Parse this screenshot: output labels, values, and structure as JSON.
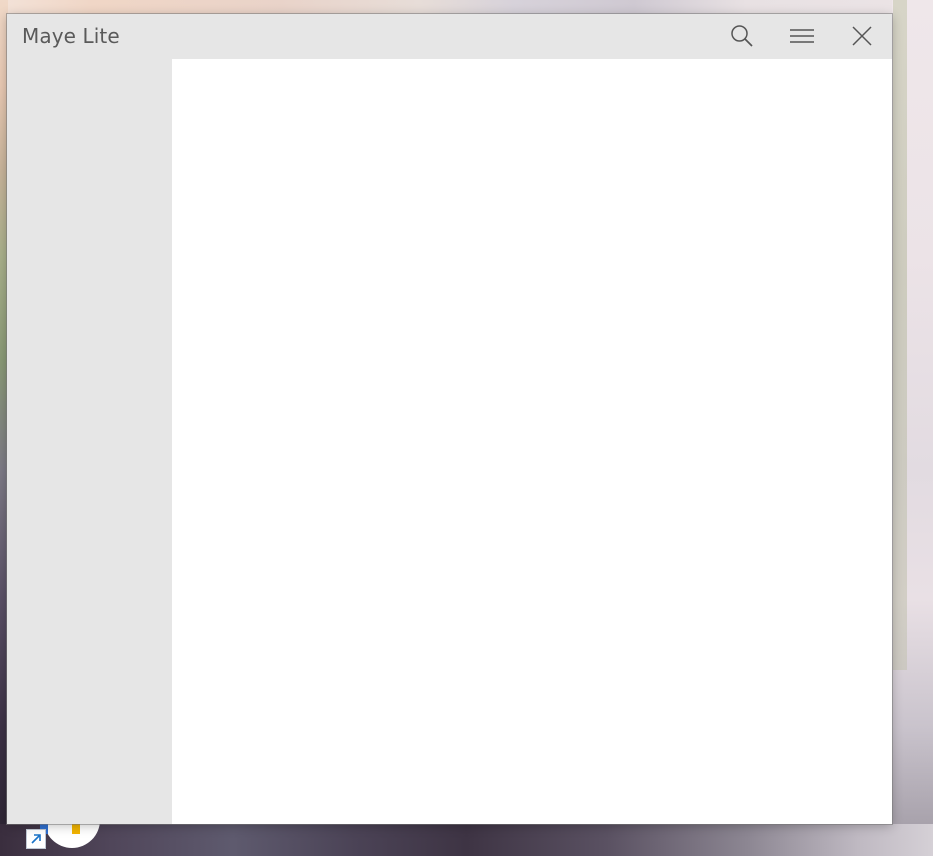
{
  "window": {
    "title": "Maye Lite"
  },
  "titlebar": {
    "buttons": [
      {
        "icon": "search-icon"
      },
      {
        "icon": "hamburger-menu-icon"
      },
      {
        "icon": "close-icon"
      }
    ]
  },
  "desktop": {
    "shortcut_icon": "shortcut-arrow-icon"
  },
  "colors": {
    "titlebar_bg": "#e6e6e6",
    "sidebar_bg": "#e6e6e6",
    "content_bg": "#ffffff",
    "title_text": "#5a5a5a",
    "icon_stroke": "#555555"
  }
}
